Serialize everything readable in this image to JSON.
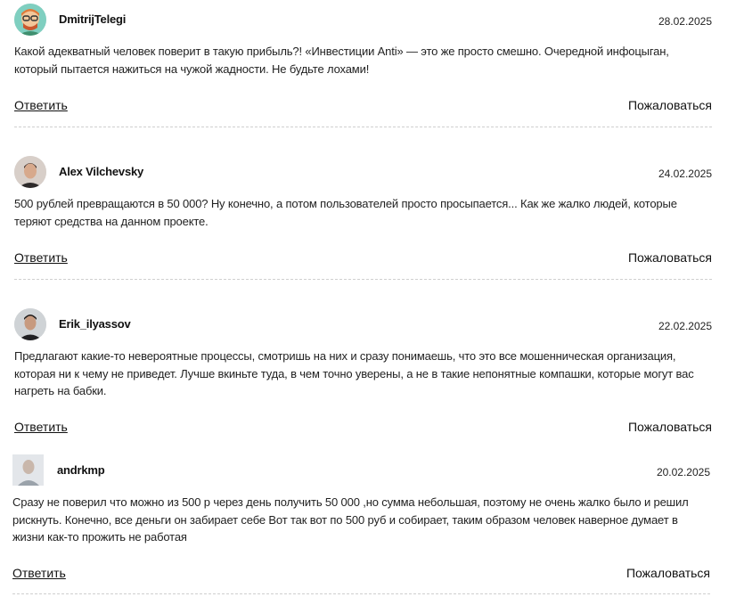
{
  "comments": [
    {
      "author": "DmitrijTelegi",
      "date": "28.02.2025",
      "text": "Какой адекватный человек поверит в такую прибыль?! «Инвестиции Anti» — это же просто смешно. Очередной инфоцыган, который пытается нажиться на чужой жадности. Не будьте лохами!",
      "reply_label": "Ответить",
      "report_label": "Пожаловаться"
    },
    {
      "author": "Alex Vilchevsky",
      "date": "24.02.2025",
      "text": "500 рублей превращаются в 50 000? Ну конечно, а потом пользователей просто просыпается... Как же жалко людей, которые теряют средства на данном проекте.",
      "reply_label": "Ответить",
      "report_label": "Пожаловаться"
    },
    {
      "author": "Erik_ilyassov",
      "date": "22.02.2025",
      "text": "Предлагают какие-то невероятные процессы, смотришь на них и сразу понимаешь, что это все мошенническая организация, которая ни к чему не приведет. Лучше вкиньте туда, в чем точно уверены, а не в такие непонятные компашки, которые могут вас нагреть на бабки.",
      "reply_label": "Ответить",
      "report_label": "Пожаловаться"
    },
    {
      "author": "andrkmp",
      "date": "20.02.2025",
      "text": "Сразу не поверил что можно из 500 р через день получить 50 000 ,но сумма небольшая, поэтому не очень жалко было и решил рискнуть. Конечно, все деньги он забирает себе Вот так вот по 500 руб и собирает, таким образом человек наверное думает в жизни как-то прожить не работая",
      "reply_label": "Ответить",
      "report_label": "Пожаловаться"
    }
  ]
}
